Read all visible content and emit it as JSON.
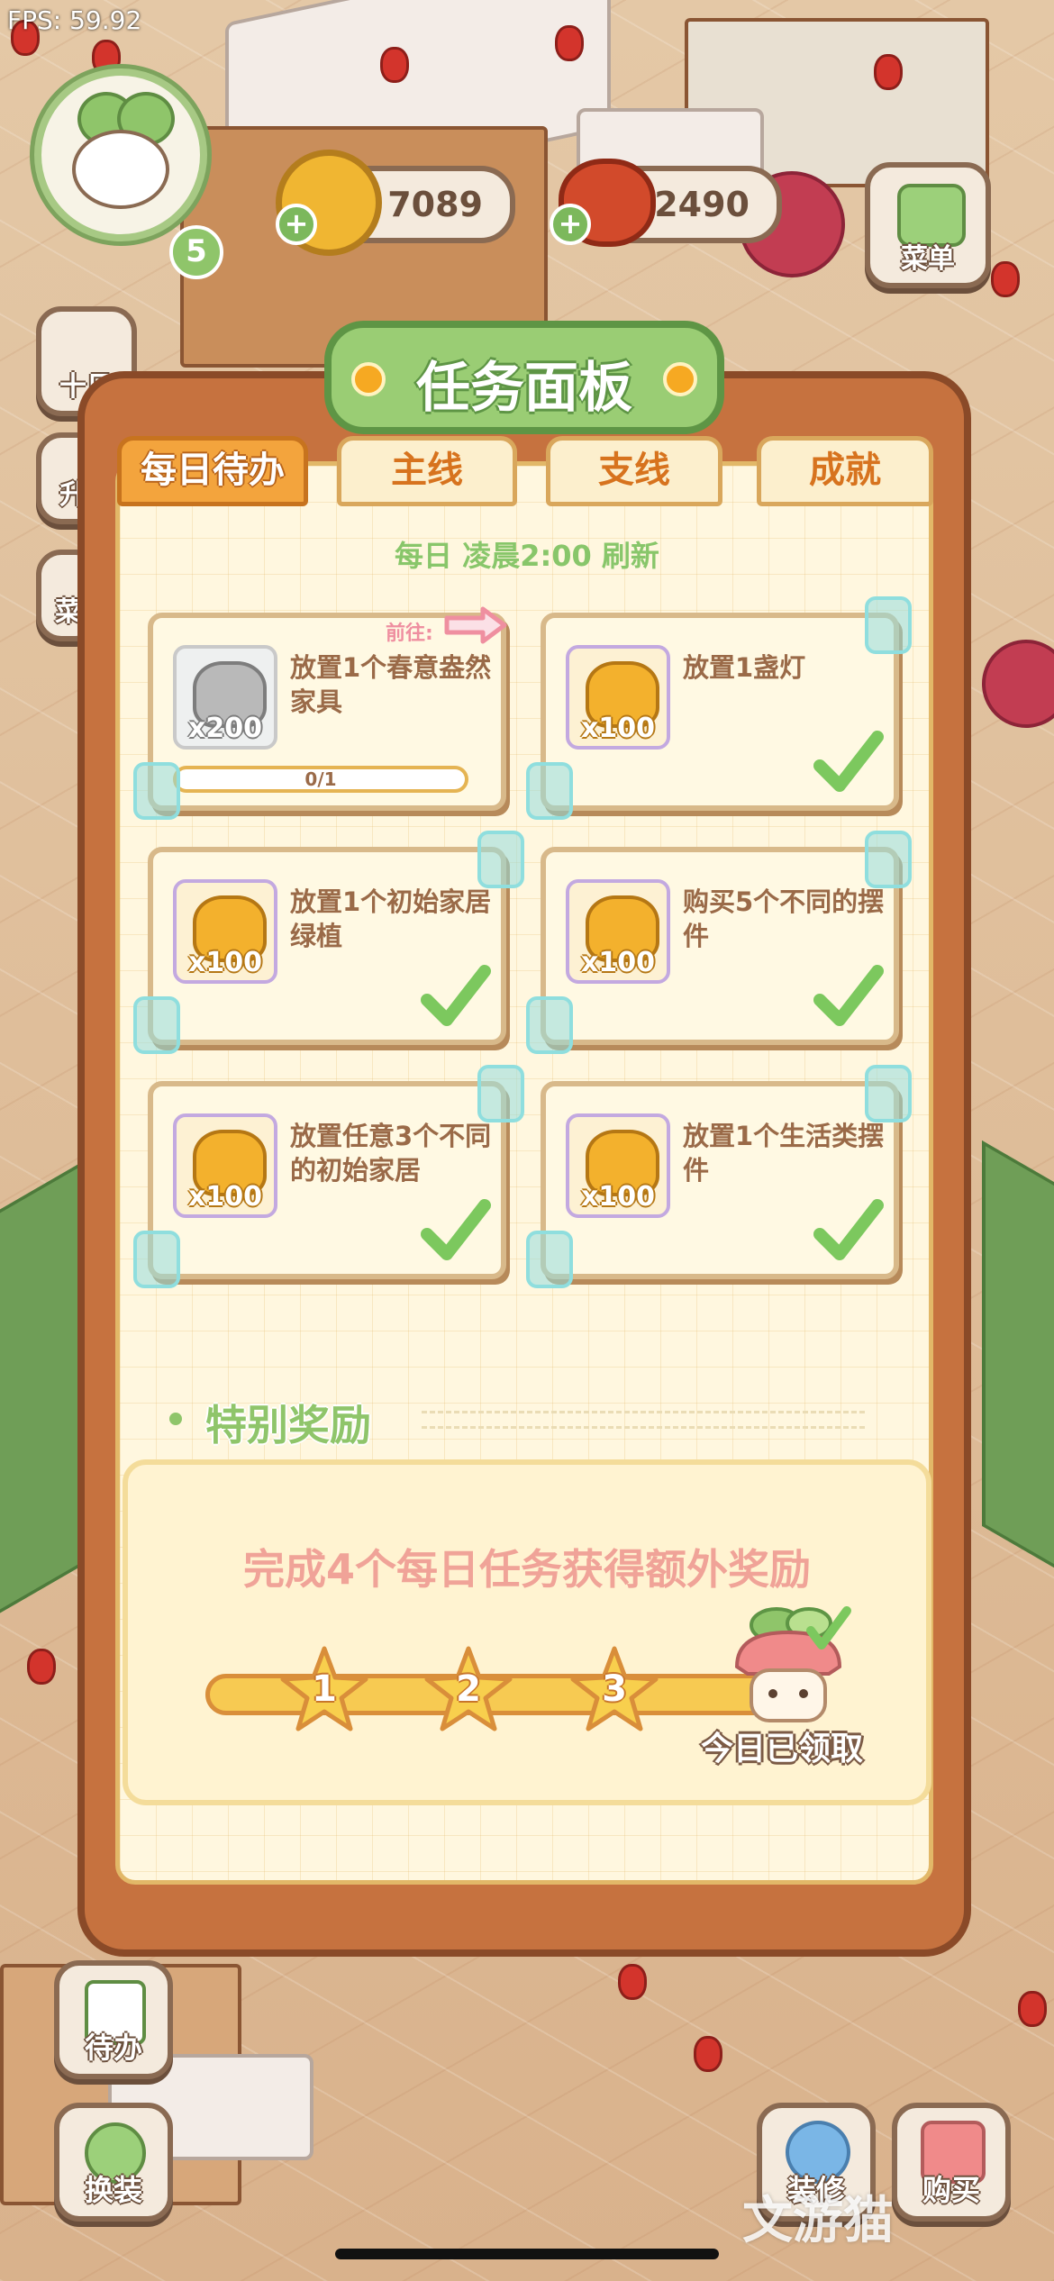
{
  "status": {
    "fps": "FPS: 59.92"
  },
  "hud": {
    "level": "5",
    "coins": "7089",
    "food": "2490",
    "menu_label": "菜单",
    "side_left_labels": [
      "十日",
      "升",
      "菜"
    ]
  },
  "panel": {
    "title": "任务面板",
    "tabs": [
      "每日待办",
      "主线",
      "支线",
      "成就"
    ],
    "active_tab": "每日待办",
    "refresh_note": "每日 凌晨2:00 刷新",
    "go_label": "前往:"
  },
  "tasks": [
    {
      "desc": "放置1个春意盎然家具",
      "reward_qty": "x200",
      "reward_style": "gray",
      "progress": "0/1",
      "completed": false
    },
    {
      "desc": "放置1盏灯",
      "reward_qty": "x100",
      "reward_style": "gold",
      "completed": true
    },
    {
      "desc": "放置1个初始家居绿植",
      "reward_qty": "x100",
      "reward_style": "gold",
      "completed": true
    },
    {
      "desc": "购买5个不同的摆件",
      "reward_qty": "x100",
      "reward_style": "gold",
      "completed": true
    },
    {
      "desc": "放置任意3个不同的初始家居",
      "reward_qty": "x100",
      "reward_style": "gold",
      "completed": true
    },
    {
      "desc": "放置1个生活类摆件",
      "reward_qty": "x100",
      "reward_style": "gold",
      "completed": true
    }
  ],
  "special": {
    "title": "特别奖励",
    "description": "完成4个每日任务获得额外奖励",
    "milestones": [
      "1",
      "2",
      "3"
    ],
    "claimed_label": "今日已领取"
  },
  "bottom": {
    "todo_label": "待办",
    "outfit_label": "换装",
    "decorate_label": "装修",
    "buy_label": "购买"
  },
  "watermark": "文游猫",
  "colors": {
    "accent_green": "#8fc56a",
    "panel_orange": "#c6723f",
    "tab_active": "#f3a43d",
    "coin_gold": "#f0b632"
  }
}
